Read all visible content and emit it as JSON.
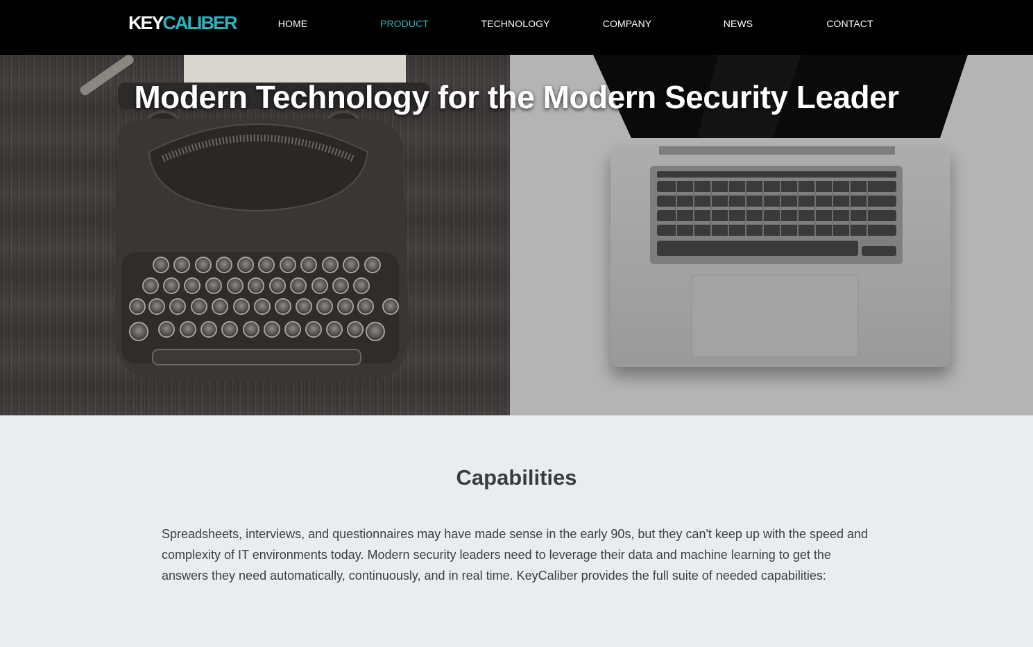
{
  "brand": {
    "logo_part1": "KEY",
    "logo_part2": "CALIBER",
    "accent_color": "#2bb4c2"
  },
  "nav": {
    "items": [
      {
        "label": "HOME",
        "active": false
      },
      {
        "label": "PRODUCT",
        "active": true
      },
      {
        "label": "TECHNOLOGY",
        "active": false
      },
      {
        "label": "COMPANY",
        "active": false
      },
      {
        "label": "NEWS",
        "active": false
      },
      {
        "label": "CONTACT",
        "active": false
      }
    ]
  },
  "hero": {
    "title": "Modern Technology for the Modern Security Leader",
    "left_image": "typewriter-image",
    "right_image": "laptop-image"
  },
  "capabilities": {
    "title": "Capabilities",
    "body": "Spreadsheets, interviews, and questionnaires may have made sense in the early 90s, but they can't keep up with the speed and complexity of IT environments today. Modern security leaders need to leverage their data and machine learning to get the answers they need automatically, continuously, and in real time. KeyCaliber provides the full suite of needed capabilities:"
  }
}
